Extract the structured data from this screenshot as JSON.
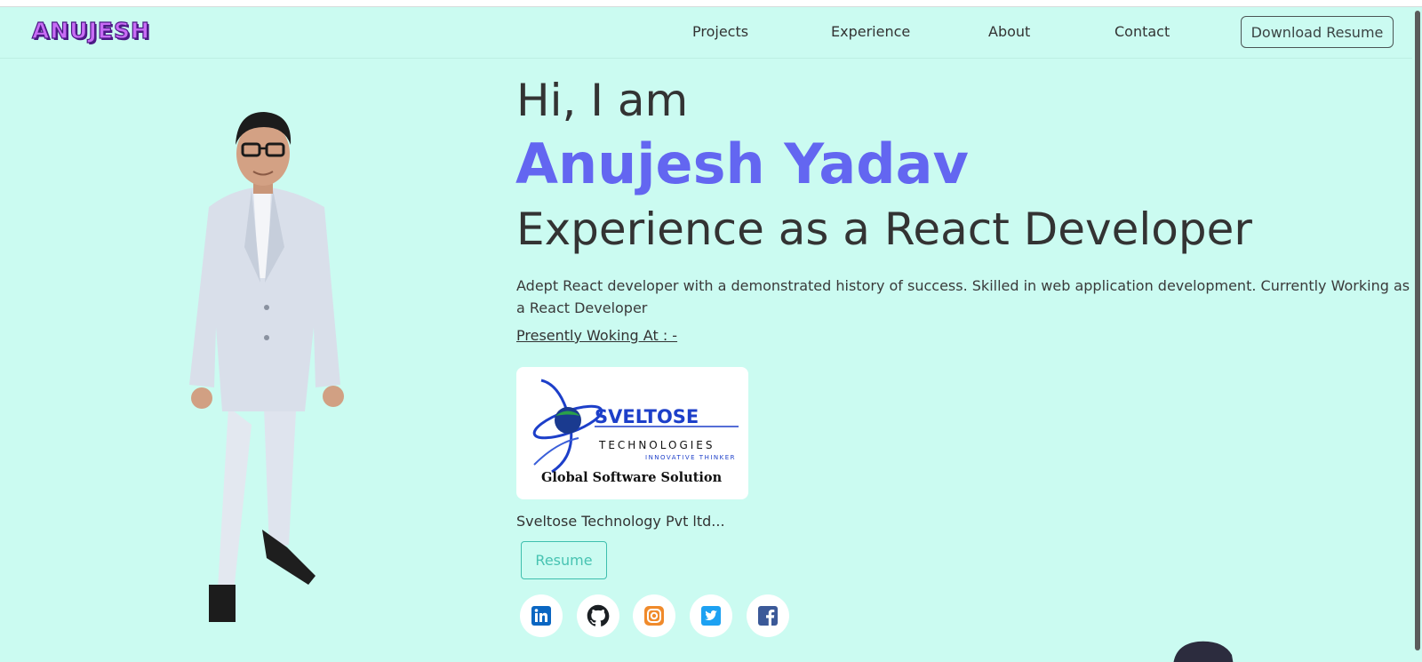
{
  "nav": {
    "logo": "ANUJESH",
    "links": [
      "Projects",
      "Experience",
      "About",
      "Contact"
    ],
    "download_label": "Download Resume"
  },
  "hero": {
    "greeting": "Hi, I am",
    "name": "Anujesh Yadav",
    "role": "Experience as a React Developer",
    "description": "Adept React developer with a demonstrated history of success. Skilled in web application development. Currently Working as a React Developer",
    "present_label": "Presently Woking At : -",
    "company_logo": {
      "name_line": "SVELTOSE",
      "sub_line": "TECHNOLOGIES",
      "tagline": "INNOVATIVE THINKER",
      "slogan": "Global Software Solution"
    },
    "company_name": "Sveltose Technology Pvt ltd...",
    "resume_label": "Resume"
  },
  "social": [
    {
      "name": "linkedin",
      "icon": "linkedin-icon",
      "color": "#0a66c2"
    },
    {
      "name": "github",
      "icon": "github-icon",
      "color": "#1b1f23"
    },
    {
      "name": "instagram",
      "icon": "instagram-icon",
      "color": "#f08a2b"
    },
    {
      "name": "twitter",
      "icon": "twitter-icon",
      "color": "#1da1f2"
    },
    {
      "name": "facebook",
      "icon": "facebook-icon",
      "color": "#3b5998"
    }
  ],
  "colors": {
    "background": "#cbfbf1",
    "accent": "#6366f1",
    "resume_button": "#48c3b2"
  }
}
